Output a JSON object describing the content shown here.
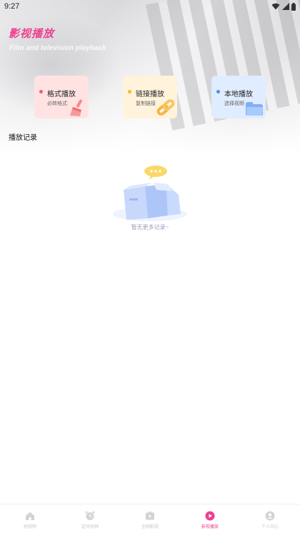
{
  "status_bar": {
    "time": "9:27"
  },
  "header": {
    "title": "影视播放",
    "subtitle": "Film and television playback"
  },
  "cards": [
    {
      "title": "格式播放",
      "subtitle": "必转格式",
      "bg": "#ffe3e3",
      "dot": "#f25b6b",
      "icon": "broom-icon"
    },
    {
      "title": "链接播放",
      "subtitle": "复制链接",
      "bg": "#fff3dc",
      "dot": "#f5b92e",
      "icon": "link-icon"
    },
    {
      "title": "本地播放",
      "subtitle": "选择视频",
      "bg": "#e0ecff",
      "dot": "#4b8df5",
      "icon": "folder-icon"
    }
  ],
  "section": {
    "title": "播放记录"
  },
  "empty": {
    "text": "暂无更多记录~"
  },
  "tabs": [
    {
      "label": "短视频",
      "icon": "home-icon",
      "active": false
    },
    {
      "label": "定时闹钟",
      "icon": "alarm-icon",
      "active": false
    },
    {
      "label": "全网影视",
      "icon": "video-icon",
      "active": false
    },
    {
      "label": "影视播放",
      "icon": "play-icon",
      "active": true
    },
    {
      "label": "个人中心",
      "icon": "user-icon",
      "active": false
    }
  ],
  "colors": {
    "accent": "#ee3f8e",
    "inactive": "#c8c8c8"
  }
}
